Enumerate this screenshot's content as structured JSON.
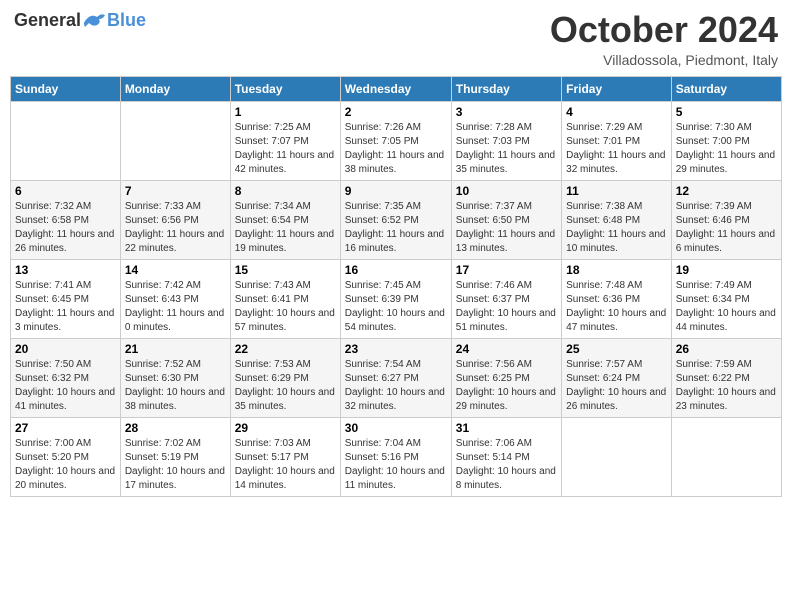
{
  "header": {
    "logo_general": "General",
    "logo_blue": "Blue",
    "month_title": "October 2024",
    "location": "Villadossola, Piedmont, Italy"
  },
  "days_of_week": [
    "Sunday",
    "Monday",
    "Tuesday",
    "Wednesday",
    "Thursday",
    "Friday",
    "Saturday"
  ],
  "weeks": [
    [
      {
        "day": "",
        "info": ""
      },
      {
        "day": "",
        "info": ""
      },
      {
        "day": "1",
        "info": "Sunrise: 7:25 AM\nSunset: 7:07 PM\nDaylight: 11 hours and 42 minutes."
      },
      {
        "day": "2",
        "info": "Sunrise: 7:26 AM\nSunset: 7:05 PM\nDaylight: 11 hours and 38 minutes."
      },
      {
        "day": "3",
        "info": "Sunrise: 7:28 AM\nSunset: 7:03 PM\nDaylight: 11 hours and 35 minutes."
      },
      {
        "day": "4",
        "info": "Sunrise: 7:29 AM\nSunset: 7:01 PM\nDaylight: 11 hours and 32 minutes."
      },
      {
        "day": "5",
        "info": "Sunrise: 7:30 AM\nSunset: 7:00 PM\nDaylight: 11 hours and 29 minutes."
      }
    ],
    [
      {
        "day": "6",
        "info": "Sunrise: 7:32 AM\nSunset: 6:58 PM\nDaylight: 11 hours and 26 minutes."
      },
      {
        "day": "7",
        "info": "Sunrise: 7:33 AM\nSunset: 6:56 PM\nDaylight: 11 hours and 22 minutes."
      },
      {
        "day": "8",
        "info": "Sunrise: 7:34 AM\nSunset: 6:54 PM\nDaylight: 11 hours and 19 minutes."
      },
      {
        "day": "9",
        "info": "Sunrise: 7:35 AM\nSunset: 6:52 PM\nDaylight: 11 hours and 16 minutes."
      },
      {
        "day": "10",
        "info": "Sunrise: 7:37 AM\nSunset: 6:50 PM\nDaylight: 11 hours and 13 minutes."
      },
      {
        "day": "11",
        "info": "Sunrise: 7:38 AM\nSunset: 6:48 PM\nDaylight: 11 hours and 10 minutes."
      },
      {
        "day": "12",
        "info": "Sunrise: 7:39 AM\nSunset: 6:46 PM\nDaylight: 11 hours and 6 minutes."
      }
    ],
    [
      {
        "day": "13",
        "info": "Sunrise: 7:41 AM\nSunset: 6:45 PM\nDaylight: 11 hours and 3 minutes."
      },
      {
        "day": "14",
        "info": "Sunrise: 7:42 AM\nSunset: 6:43 PM\nDaylight: 11 hours and 0 minutes."
      },
      {
        "day": "15",
        "info": "Sunrise: 7:43 AM\nSunset: 6:41 PM\nDaylight: 10 hours and 57 minutes."
      },
      {
        "day": "16",
        "info": "Sunrise: 7:45 AM\nSunset: 6:39 PM\nDaylight: 10 hours and 54 minutes."
      },
      {
        "day": "17",
        "info": "Sunrise: 7:46 AM\nSunset: 6:37 PM\nDaylight: 10 hours and 51 minutes."
      },
      {
        "day": "18",
        "info": "Sunrise: 7:48 AM\nSunset: 6:36 PM\nDaylight: 10 hours and 47 minutes."
      },
      {
        "day": "19",
        "info": "Sunrise: 7:49 AM\nSunset: 6:34 PM\nDaylight: 10 hours and 44 minutes."
      }
    ],
    [
      {
        "day": "20",
        "info": "Sunrise: 7:50 AM\nSunset: 6:32 PM\nDaylight: 10 hours and 41 minutes."
      },
      {
        "day": "21",
        "info": "Sunrise: 7:52 AM\nSunset: 6:30 PM\nDaylight: 10 hours and 38 minutes."
      },
      {
        "day": "22",
        "info": "Sunrise: 7:53 AM\nSunset: 6:29 PM\nDaylight: 10 hours and 35 minutes."
      },
      {
        "day": "23",
        "info": "Sunrise: 7:54 AM\nSunset: 6:27 PM\nDaylight: 10 hours and 32 minutes."
      },
      {
        "day": "24",
        "info": "Sunrise: 7:56 AM\nSunset: 6:25 PM\nDaylight: 10 hours and 29 minutes."
      },
      {
        "day": "25",
        "info": "Sunrise: 7:57 AM\nSunset: 6:24 PM\nDaylight: 10 hours and 26 minutes."
      },
      {
        "day": "26",
        "info": "Sunrise: 7:59 AM\nSunset: 6:22 PM\nDaylight: 10 hours and 23 minutes."
      }
    ],
    [
      {
        "day": "27",
        "info": "Sunrise: 7:00 AM\nSunset: 5:20 PM\nDaylight: 10 hours and 20 minutes."
      },
      {
        "day": "28",
        "info": "Sunrise: 7:02 AM\nSunset: 5:19 PM\nDaylight: 10 hours and 17 minutes."
      },
      {
        "day": "29",
        "info": "Sunrise: 7:03 AM\nSunset: 5:17 PM\nDaylight: 10 hours and 14 minutes."
      },
      {
        "day": "30",
        "info": "Sunrise: 7:04 AM\nSunset: 5:16 PM\nDaylight: 10 hours and 11 minutes."
      },
      {
        "day": "31",
        "info": "Sunrise: 7:06 AM\nSunset: 5:14 PM\nDaylight: 10 hours and 8 minutes."
      },
      {
        "day": "",
        "info": ""
      },
      {
        "day": "",
        "info": ""
      }
    ]
  ]
}
